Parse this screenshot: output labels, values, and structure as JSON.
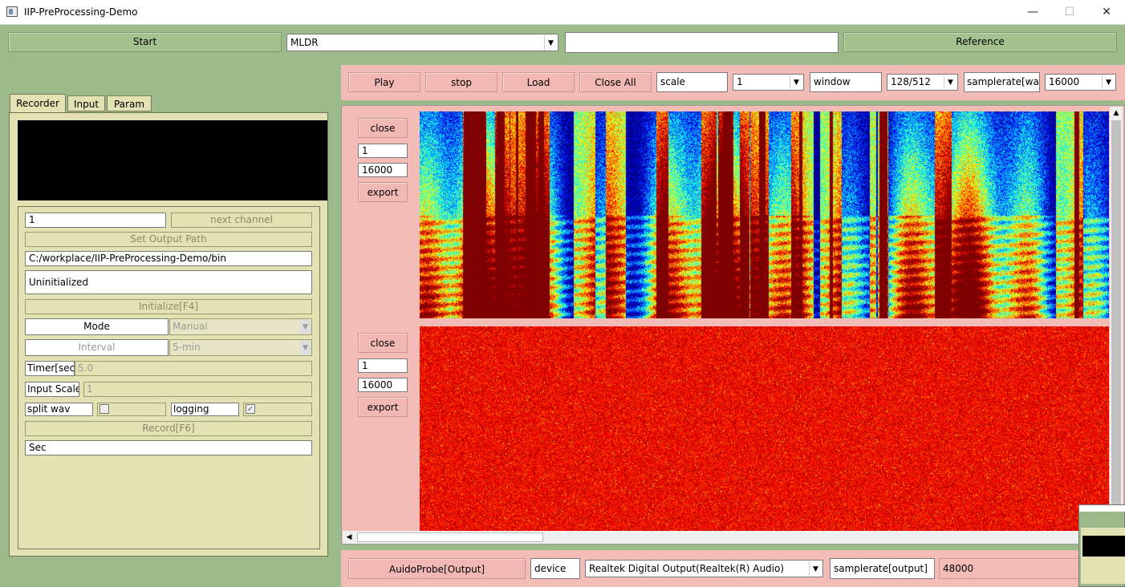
{
  "window": {
    "title": "IIP-PreProcessing-Demo",
    "minimize": "—",
    "maximize": "☐",
    "close": "✕"
  },
  "topbar": {
    "start_label": "Start",
    "model_select": "MLDR",
    "text_input": "",
    "reference_label": "Reference"
  },
  "tabs": [
    "Recorder",
    "Input",
    "Param"
  ],
  "recorder": {
    "channel_value": "1",
    "next_channel_label": "next channel",
    "set_output_path_label": "Set Output Path",
    "output_path": "C:/workplace/IIP-PreProcessing-Demo/bin",
    "status": "Uninitialized",
    "initialize_label": "Initialize[F4]",
    "mode_label": "Mode",
    "mode_value": "Manual",
    "interval_label": "Interval",
    "interval_value": "5-min",
    "timer_label": "Timer[sec]",
    "timer_value": "5.0",
    "input_scale_label": "Input Scale",
    "input_scale_value": "1",
    "split_wav_label": "split wav",
    "split_wav_checked": false,
    "logging_label": "logging",
    "logging_checked": true,
    "record_label": "Record[F6]",
    "sec_value": "Sec"
  },
  "playbar": {
    "play": "Play",
    "stop": "stop",
    "load": "Load",
    "close_all": "Close All",
    "scale_label": "scale",
    "scale_value": "1",
    "window_label": "window",
    "window_value": "128/512",
    "samplerate_label": "samplerate[wav]",
    "samplerate_value": "16000"
  },
  "tracks": [
    {
      "close": "close",
      "channel": "1",
      "rate": "16000",
      "export": "export"
    },
    {
      "close": "close",
      "channel": "1",
      "rate": "16000",
      "export": "export"
    }
  ],
  "bottombar": {
    "audioprobe_label": "AuidoProbe[Output]",
    "device_label": "device",
    "device_value": "Realtek Digital Output(Realtek(R) Audio)",
    "samplerate_label": "samplerate[output]",
    "samplerate_value": "48000"
  },
  "colors": {
    "background": "#9dba8a",
    "panel_pink": "#f4bcb6",
    "panel_khaki": "#e2e2b2",
    "spectrogram_high": "#cc1a10",
    "spectrogram_low": "#2f8fd8"
  }
}
